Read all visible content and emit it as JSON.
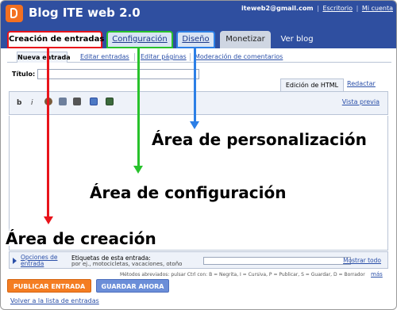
{
  "header": {
    "blog_title": "Blog ITE web 2.0",
    "user_email": "iteweb2@gmail.com",
    "separator": "|",
    "escritorio_link": "Escritorio",
    "account_link": "Mi cuenta"
  },
  "tabs": {
    "create": "Creación de entradas",
    "config": "Configuración",
    "design": "Diseño",
    "monetize": "Monetizar",
    "view_blog": "Ver blog"
  },
  "subtabs": {
    "new_post": "Nueva entrada",
    "edit_posts": "Editar entradas",
    "edit_pages": "Editar páginas",
    "moderation": "Moderación de comentarios"
  },
  "post": {
    "title_label": "Título:",
    "title_value": ""
  },
  "editor": {
    "mode_html": "Edición de HTML",
    "mode_compose": "Redactar",
    "bold": "b",
    "italic": "i",
    "preview": "Vista previa",
    "body": ""
  },
  "options": {
    "link": "Opciones de entrada",
    "labels_title": "Etiquetas de esta entrada:",
    "labels_hint": "por ej., motocicletas, vacaciones, otoño",
    "labels_value": "",
    "show_all": "Mostrar todo"
  },
  "shortcuts": {
    "text": "Métodos abreviados: pulsar Ctrl con: B = Negrita, I = Cursiva, P = Publicar, S = Guardar, D = Borrador",
    "more": "más"
  },
  "actions": {
    "publish": "PUBLICAR ENTRADA",
    "save": "GUARDAR AHORA",
    "back": "Volver a la lista de entradas"
  },
  "annotations": {
    "design": "Área de personalización",
    "config": "Área de configuración",
    "create": "Área de creación"
  },
  "colors": {
    "header_bg": "#2f4fa0",
    "create_highlight": "#e8141b",
    "config_highlight": "#28c22c",
    "design_highlight": "#2c7fe6",
    "publish_button": "#f47d22",
    "save_button": "#6b8ed8"
  },
  "icons": {
    "logo": "blogger-logo-icon",
    "bold": "bold-icon",
    "italic": "italic-icon",
    "font_color": "font-color-icon",
    "link": "link-icon",
    "spellcheck": "spellcheck-icon",
    "image": "insert-image-icon",
    "video": "insert-video-icon"
  }
}
